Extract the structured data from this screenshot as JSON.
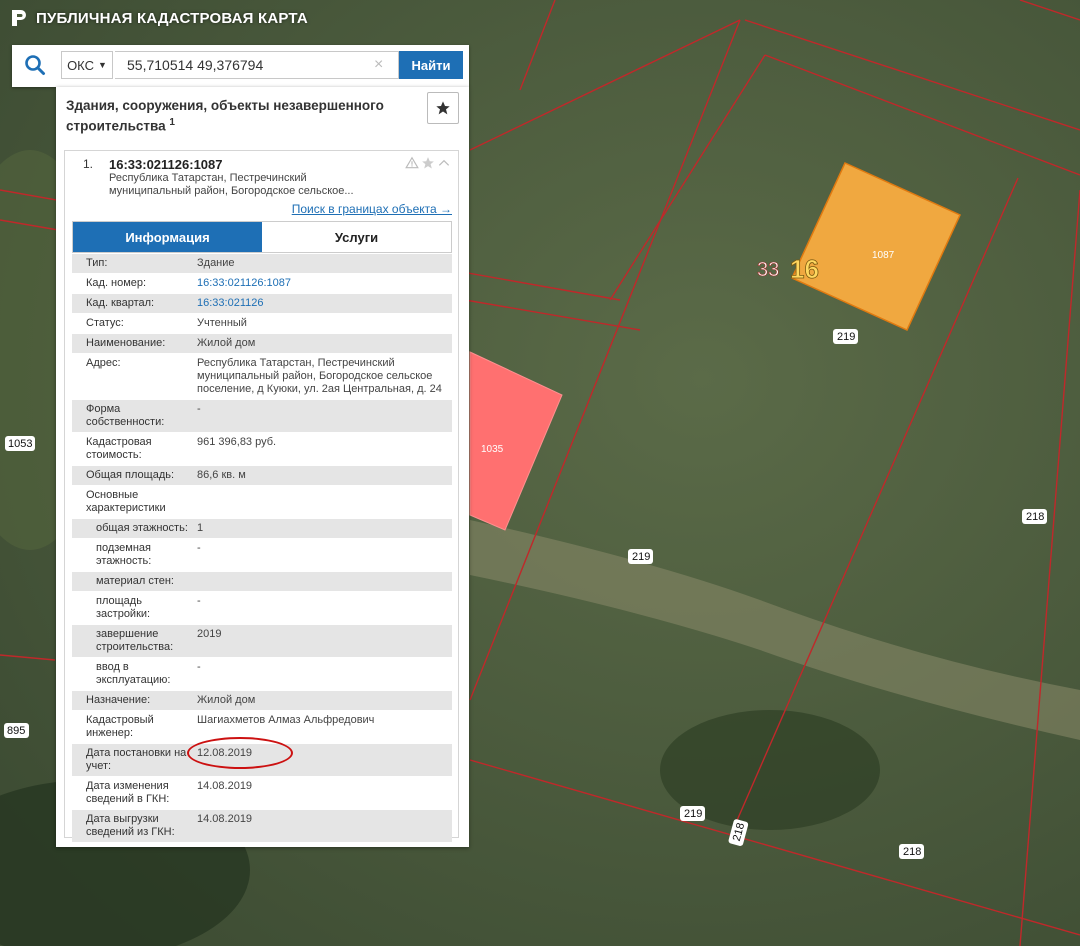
{
  "app": {
    "title": "ПУБЛИЧНАЯ КАДАСТРОВАЯ КАРТА"
  },
  "search": {
    "type": "ОКС",
    "query": "55,710514 49,376794",
    "clear": "×",
    "button": "Найти"
  },
  "panel": {
    "title": "Здания, сооружения, объекты незавершенного строительства",
    "count": "1",
    "item": {
      "number": "1.",
      "cadastral_number": "16:33:021126:1087",
      "address_short": "Республика Татарстан, Пестречинский муниципальный район, Богородское сельское...",
      "boundary_link": "Поиск в границах объекта →"
    },
    "tabs": {
      "info": "Информация",
      "services": "Услуги"
    },
    "rows": [
      {
        "label": "Тип:",
        "value": "Здание"
      },
      {
        "label": "Кад. номер:",
        "value": "16:33:021126:1087"
      },
      {
        "label": "Кад. квартал:",
        "value": "16:33:021126"
      },
      {
        "label": "Статус:",
        "value": "Учтенный"
      },
      {
        "label": "Наименование:",
        "value": "Жилой дом"
      },
      {
        "label": "Адрес:",
        "value": "Республика Татарстан, Пестречинский муниципальный район, Богородское сельское поселение, д Куюки, ул. 2ая Центральная, д. 24"
      },
      {
        "label": "Форма собственности:",
        "value": "-"
      },
      {
        "label": "Кадастровая стоимость:",
        "value": "961 396,83 руб."
      },
      {
        "label": "Общая площадь:",
        "value": "86,6 кв. м"
      },
      {
        "label": "Основные характеристики",
        "value": ""
      },
      {
        "label": "общая этажность:",
        "value": "1"
      },
      {
        "label": "подземная этажность:",
        "value": "-"
      },
      {
        "label": "материал стен:",
        "value": ""
      },
      {
        "label": "площадь застройки:",
        "value": "-"
      },
      {
        "label": "завершение строительства:",
        "value": "2019"
      },
      {
        "label": "ввод в эксплуатацию:",
        "value": "-"
      },
      {
        "label": "Назначение:",
        "value": "Жилой дом"
      },
      {
        "label": "Кадастровый инженер:",
        "value": "Шагиахметов Алмаз Альфредович"
      },
      {
        "label": "Дата постановки на учет:",
        "value": "12.08.2019"
      },
      {
        "label": "Дата изменения сведений в ГКН:",
        "value": "14.08.2019"
      },
      {
        "label": "Дата выгрузки сведений из ГКН:",
        "value": "14.08.2019"
      }
    ]
  },
  "map": {
    "labels": {
      "district": "16",
      "block": "33",
      "building_1087": "1087",
      "building_1035": "1035",
      "p219a": "219",
      "p219b": "219",
      "p219c": "219",
      "p218a": "218",
      "p218b": "218",
      "p218c": "218",
      "p1053": "1053",
      "p895": "895"
    }
  },
  "colors": {
    "accent": "#1e6fb5",
    "parcel_line": "#c0282a",
    "building_selected": "#f0a840",
    "building_other": "#ff7070"
  }
}
